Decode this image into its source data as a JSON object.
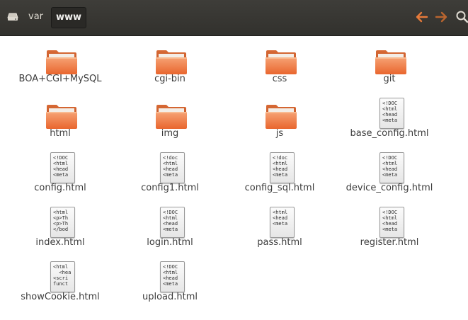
{
  "pathbar": {
    "segments": [
      "var",
      "www"
    ],
    "current": "www"
  },
  "toolbar": {
    "back_icon": "arrow-left-icon",
    "forward_icon": "arrow-right-icon",
    "search_icon": "search-icon",
    "accent": "#e95420"
  },
  "files": [
    {
      "name": "BOA+CGI+MySQL",
      "type": "folder"
    },
    {
      "name": "cgi-bin",
      "type": "folder"
    },
    {
      "name": "css",
      "type": "folder"
    },
    {
      "name": "git",
      "type": "folder"
    },
    {
      "name": "html",
      "type": "folder"
    },
    {
      "name": "img",
      "type": "folder"
    },
    {
      "name": "js",
      "type": "folder"
    },
    {
      "name": "base_config.html",
      "type": "html",
      "preview": [
        "<!DOC",
        "<html",
        "<head",
        "<meta"
      ]
    },
    {
      "name": "config.html",
      "type": "html",
      "preview": [
        "<!DOC",
        "<html",
        "<head",
        "<meta"
      ]
    },
    {
      "name": "config1.html",
      "type": "html",
      "preview": [
        "<!doc",
        "<html",
        "<head",
        "<meta"
      ]
    },
    {
      "name": "config_sql.html",
      "type": "html",
      "preview": [
        "<!doc",
        "<html",
        "<head",
        "<meta"
      ]
    },
    {
      "name": "device_config.html",
      "type": "html",
      "preview": [
        "<!DOC",
        "<html",
        "<head",
        "<meta"
      ]
    },
    {
      "name": "index.html",
      "type": "html",
      "preview": [
        "<html",
        "<p>Th",
        "<p>Th",
        "</bod"
      ]
    },
    {
      "name": "login.html",
      "type": "html",
      "preview": [
        "<!DOC",
        "<html",
        "<head",
        "<meta"
      ]
    },
    {
      "name": "pass.html",
      "type": "html",
      "preview": [
        "",
        "<html",
        "<head",
        "<meta"
      ]
    },
    {
      "name": "register.html",
      "type": "html",
      "preview": [
        "<!DOC",
        "<html",
        "<head",
        "<meta"
      ]
    },
    {
      "name": "showCookie.html",
      "type": "html",
      "preview": [
        "<html",
        "  <hea",
        "<scri",
        "funct"
      ]
    },
    {
      "name": "upload.html",
      "type": "html",
      "preview": [
        "<!DOC",
        "<html",
        "<head",
        "<meta"
      ]
    }
  ]
}
